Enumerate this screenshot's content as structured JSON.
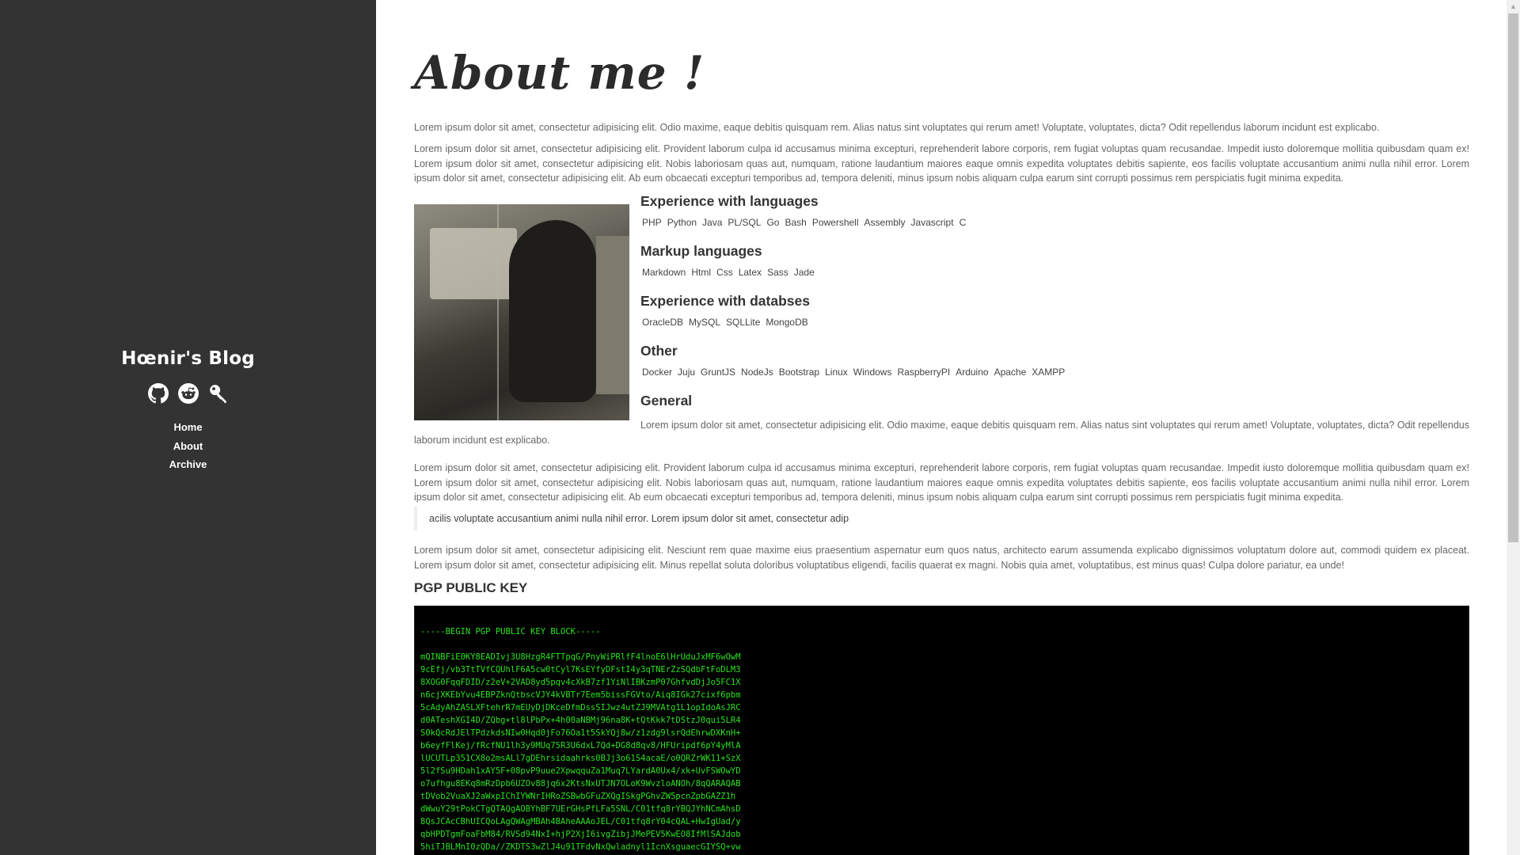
{
  "sidebar": {
    "blog_title": "Hœnir's Blog",
    "social": [
      {
        "name": "github-icon"
      },
      {
        "name": "reddit-icon"
      },
      {
        "name": "key-icon"
      }
    ],
    "nav": [
      "Home",
      "About",
      "Archive"
    ]
  },
  "main": {
    "title": "About me !",
    "intro_1": "Lorem ipsum dolor sit amet, consectetur adipisicing elit. Odio maxime, eaque debitis quisquam rem. Alias natus sint voluptates qui rerum amet! Voluptate, voluptates, dicta? Odit repellendus laborum incidunt est explicabo.",
    "intro_2": "Lorem ipsum dolor sit amet, consectetur adipisicing elit. Provident laborum culpa id accusamus minima excepturi, reprehenderit labore corporis, rem fugiat voluptas quam recusandae. Impedit iusto doloremque mollitia quibusdam quam ex! Lorem ipsum dolor sit amet, consectetur adipisicing elit. Nobis laboriosam quas aut, numquam, ratione laudantium maiores eaque omnis expedita voluptates debitis sapiente, eos facilis voluptate accusantium animi nulla nihil error. Lorem ipsum dolor sit amet, consectetur adipisicing elit. Ab eum obcaecati excepturi temporibus ad, tempora deleniti, minus ipsum nobis aliquam culpa earum sint corrupti possimus rem perspiciatis fugit minima expedita.",
    "sections": [
      {
        "title": "Experience with languages",
        "tags": [
          "PHP",
          "Python",
          "Java",
          "PL/SQL",
          "Go",
          "Bash",
          "Powershell",
          "Assembly",
          "Javascript",
          "C"
        ]
      },
      {
        "title": "Markup languages",
        "tags": [
          "Markdown",
          "Html",
          "Css",
          "Latex",
          "Sass",
          "Jade"
        ]
      },
      {
        "title": "Experience with databses",
        "tags": [
          "OracleDB",
          "MySQL",
          "SQLLite",
          "MongoDB"
        ]
      },
      {
        "title": "Other",
        "tags": [
          "Docker",
          "Juju",
          "GruntJS",
          "NodeJs",
          "Bootstrap",
          "Linux",
          "Windows",
          "RaspberryPI",
          "Arduino",
          "Apache",
          "XAMPP"
        ]
      }
    ],
    "general_title": "General",
    "general_1": "Lorem ipsum dolor sit amet, consectetur adipisicing elit. Odio maxime, eaque debitis quisquam rem. Alias natus sint voluptates qui rerum amet! Voluptate, voluptates, dicta? Odit repellendus laborum incidunt est explicabo.",
    "general_2": "Lorem ipsum dolor sit amet, consectetur adipisicing elit. Provident laborum culpa id accusamus minima excepturi, reprehenderit labore corporis, rem fugiat voluptas quam recusandae. Impedit iusto doloremque mollitia quibusdam quam ex! Lorem ipsum dolor sit amet, consectetur adipisicing elit. Nobis laboriosam quas aut, numquam, ratione laudantium maiores eaque omnis expedita voluptates debitis sapiente, eos facilis voluptate accusantium animi nulla nihil error. Lorem ipsum dolor sit amet, consectetur adipisicing elit. Ab eum obcaecati excepturi temporibus ad, tempora deleniti, minus ipsum nobis aliquam culpa earum sint corrupti possimus rem perspiciatis fugit minima expedita.",
    "quote": "acilis voluptate accusantium animi nulla nihil error. Lorem ipsum dolor sit amet, consectetur adip",
    "closing": "Lorem ipsum dolor sit amet, consectetur adipisicing elit. Nesciunt rem quae maxime eius praesentium aspernatur eum quos natus, architecto earum assumenda explicabo dignissimos voluptatum dolore aut, commodi quidem ex placeat. Lorem ipsum dolor sit amet, consectetur adipisicing elit. Minus repellat soluta doloribus voluptatibus eligendi, facilis quaerat ex magni. Nobis quia amet, voluptatibus, est minus quas! Culpa dolore pariatur, ea unde!",
    "pgp_title": "PGP PUBLIC KEY",
    "pgp_key": "-----BEGIN PGP PUBLIC KEY BLOCK-----\n\nmQINBFiE0KY8EADIvj3U8HzgR4FTTpqG/PnyWiPRlfF4lnoE6lHrUduJxMF6wOwM\n9cEfj/vb3TtTVfCQUhlF6A5cw0tCyl7KsEYfyDFstI4y3qTNErZzSQdbFtFoDLM3\n8XOG0FqqFDID/z2eV+2VAD8yd5pqv4cXkB7zf1YiNlIBKzmP07GhfvdDjJo5FC1X\nn6cjXKEbYvu4EBPZknQtbscVJY4kVBTr7Eem5bissFGVto/Aiq8IGk27cixf6pbm\n5cAdyAhZASLXFtehrR7mEUyDjDKceDfmDssSIJwz4utZJ9MVAtg1L1opIdoAsJRC\nd0ATeshXGI4D/ZQbg+tl8lPbPx+4h00aNBMj96na8K+tQtKkk7tDStzJ0qui5LR4\nS0kQcRdJElTPdzkdsNIw0Hqd0jFo76Oa1t5SkYQj8w/z1zdg9lsrQdEhrwDXKnH+\nb6eyfFlKej/fRcfNU1lh3y9MUq75R3U6dxL7Qd+DG8d8qv8/HFUripdf6pY4yMlA\nlUCUTLp351CX8o2msALl7gDEhrsidaahrks0BJj3o61S4acaE/o0QRZrWK11+SzX\n5l2fSu9HDah1xAY5F+08pvP9uue2XpwqquZa1Muq7LYardA0Ux4/xk+UvFSWOwYD\no7ufhgu8EKq8mRzDpb6UZOv88jq6x2KtsNxUTJN7OLoK9WvzloANOh/8qQARAQAB\ntDVob2VuaXJ2aWxpIChIYWNrIHRoZSBwbGFuZXQgISkgPGhvZW5pcnZpbGAZZ1h\ndWwuY29tPokCTgQTAQgAOBYhBF7UErGHsPfLFa5SNL/C01tfq8rYBQJYhNCmAhsD\n8QsJCAcCBhUICQoLAgQWAgMBAh4BAheAAAoJEL/C01tfq8rY04cQAL+HwIgUad/y\nqbHPDTgmFoaFbM84/RVSd94NxI+hjP2XjI6ivgZibjJMePEV5KwEO8IfMlSAJdob\n5hiTJBLMnI0zQDa//ZKDTS3wZlJ4u91TFdvNxQwladnyl1IcnXsguaecGIYSQ+vw"
  }
}
